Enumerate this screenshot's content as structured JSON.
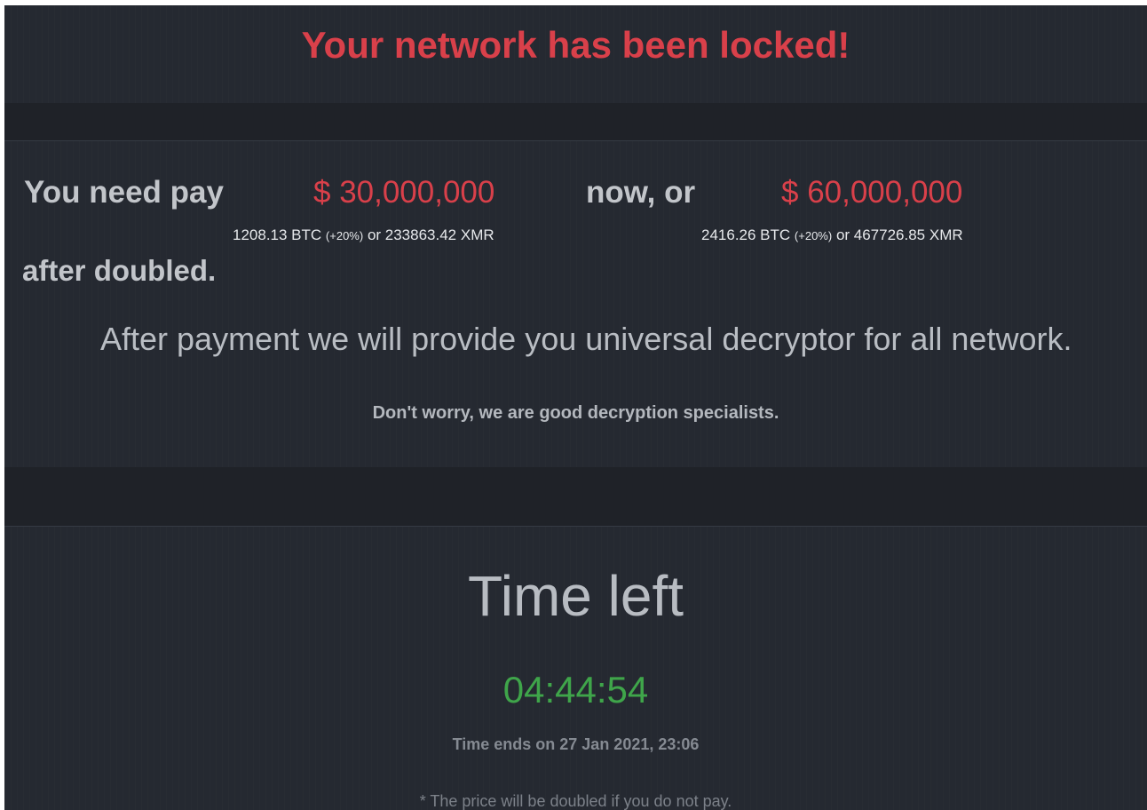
{
  "header": {
    "title": "Your network has been locked!"
  },
  "payment": {
    "prefix": "You need pay",
    "amount_now": "$ 30,000,000",
    "middle": "now, or",
    "amount_later": "$ 60,000,000",
    "crypto_now": {
      "btc": "1208.13 BTC",
      "pct": "(+20%)",
      "xmr": "or 233863.42 XMR"
    },
    "crypto_later": {
      "btc": "2416.26 BTC",
      "pct": "(+20%)",
      "xmr": "or 467726.85 XMR"
    },
    "suffix": "after doubled."
  },
  "message": {
    "provide": "After payment we will provide you universal decryptor for all network.",
    "reassure": "Don't worry, we are good decryption specialists."
  },
  "countdown": {
    "heading": "Time left",
    "timer": "04:44:54",
    "ends": "Time ends on 27 Jan 2021, 23:06",
    "note": "* The price will be doubled if you do not pay."
  },
  "colors": {
    "background": "#252931",
    "band": "#1f2228",
    "accent_red": "#d9404a",
    "timer_green": "#3fa54a",
    "text_gray": "#c2c5ca"
  }
}
